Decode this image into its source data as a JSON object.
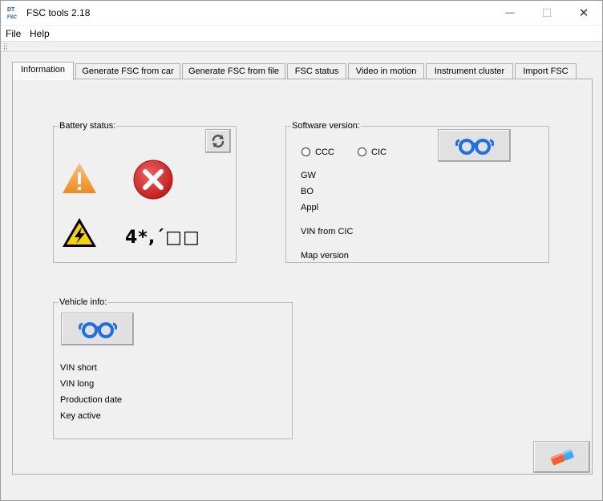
{
  "window": {
    "title": "FSC tools 2.18",
    "logo_text_top": "DT",
    "logo_text_bottom": "FSC",
    "minimize_glyph": "—",
    "maximize_glyph": "☐",
    "close_glyph": "✕"
  },
  "menu": {
    "file": "File",
    "help": "Help"
  },
  "tabs": [
    {
      "label": "Information"
    },
    {
      "label": "Generate FSC from car"
    },
    {
      "label": "Generate FSC from file"
    },
    {
      "label": "FSC status"
    },
    {
      "label": "Video in motion"
    },
    {
      "label": "Instrument cluster"
    },
    {
      "label": "Import FSC"
    }
  ],
  "battery": {
    "legend": "Battery status:",
    "code_text": "4*,´□□",
    "warning_icon": "orange-warning-triangle",
    "error_icon": "red-circle-x",
    "voltage_icon": "yellow-high-voltage-triangle",
    "refresh_icon": "refresh-arrows"
  },
  "software": {
    "legend": "Software version:",
    "radio_ccc": "CCC",
    "radio_cic": "CIC",
    "gw": "GW",
    "bo": "BO",
    "appl": "Appl",
    "vin_from_cic": "VIN from CIC",
    "map_version": "Map version",
    "read_icon": "blue-glasses"
  },
  "vehicle": {
    "legend": "Vehicle info:",
    "vin_short": "VIN short",
    "vin_long": "VIN long",
    "production_date": "Production date",
    "key_active": "Key active",
    "read_icon": "blue-glasses"
  },
  "eraser_icon": "eraser",
  "colors": {
    "glasses_blue": "#1f6fe0",
    "warning_orange": "#f0a040",
    "error_red": "#d42b2b",
    "voltage_yellow": "#f5d400",
    "eraser_orange": "#f06030",
    "eraser_blue": "#3fa9f5"
  }
}
